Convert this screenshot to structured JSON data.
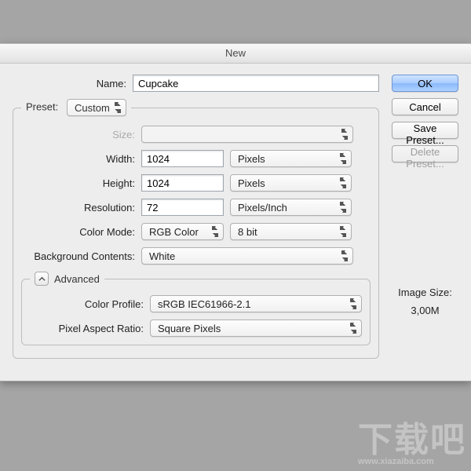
{
  "title": "New",
  "name": {
    "label": "Name:",
    "value": "Cupcake"
  },
  "preset": {
    "label": "Preset:",
    "value": "Custom"
  },
  "size": {
    "label": "Size:",
    "value": ""
  },
  "width": {
    "label": "Width:",
    "value": "1024",
    "unit": "Pixels"
  },
  "height": {
    "label": "Height:",
    "value": "1024",
    "unit": "Pixels"
  },
  "resolution": {
    "label": "Resolution:",
    "value": "72",
    "unit": "Pixels/Inch"
  },
  "colorMode": {
    "label": "Color Mode:",
    "value": "RGB Color",
    "depth": "8 bit"
  },
  "background": {
    "label": "Background Contents:",
    "value": "White"
  },
  "advanced": {
    "label": "Advanced",
    "colorProfile": {
      "label": "Color Profile:",
      "value": "sRGB IEC61966-2.1"
    },
    "pixelAspect": {
      "label": "Pixel Aspect Ratio:",
      "value": "Square Pixels"
    }
  },
  "buttons": {
    "ok": "OK",
    "cancel": "Cancel",
    "savePreset": "Save Preset...",
    "deletePreset": "Delete Preset..."
  },
  "imageSize": {
    "label": "Image Size:",
    "value": "3,00M"
  },
  "watermark": {
    "main": "下载吧",
    "sub": "www.xiazaiba.com"
  }
}
